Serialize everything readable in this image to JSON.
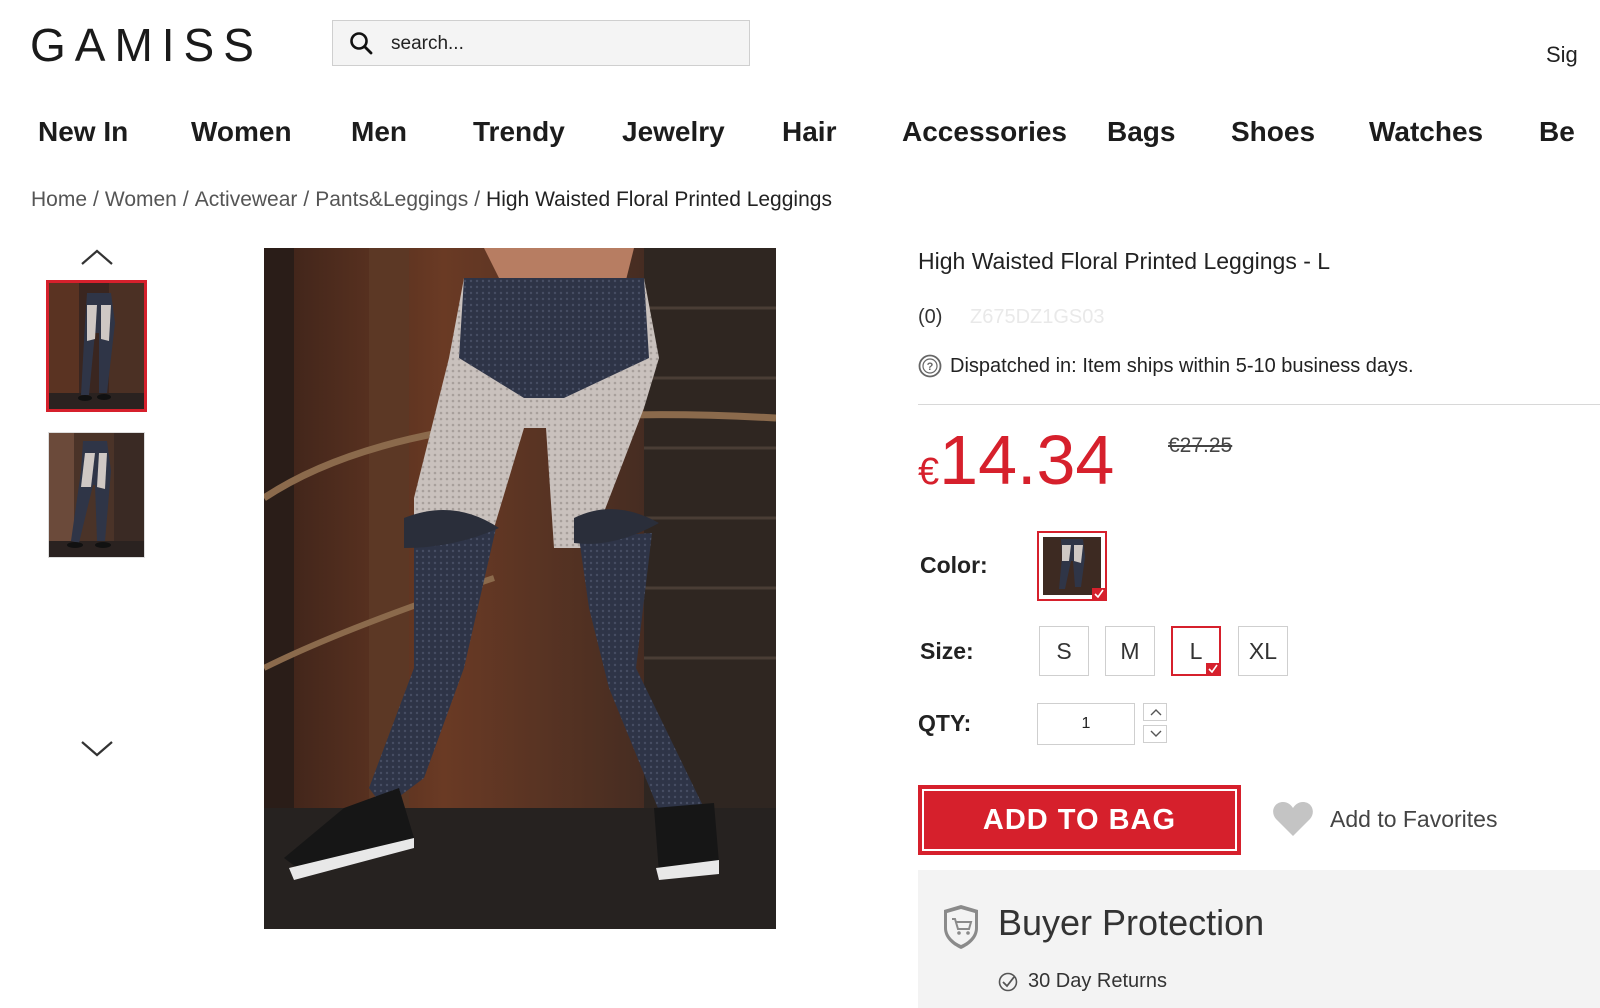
{
  "header": {
    "logo": "GAMISS",
    "search_placeholder": "search...",
    "signin_label": "Sig"
  },
  "nav": {
    "items": [
      "New In",
      "Women",
      "Men",
      "Trendy",
      "Jewelry",
      "Hair",
      "Accessories",
      "Bags",
      "Shoes",
      "Watches",
      "Be"
    ]
  },
  "breadcrumb": {
    "items": [
      "Home",
      "Women",
      "Activewear",
      "Pants&Leggings"
    ],
    "current": "High Waisted Floral Printed Leggings",
    "separator": "/"
  },
  "product": {
    "title": "High Waisted Floral Printed Leggings - L",
    "reviews": "(0)",
    "sku": "Z675DZ1GS03",
    "dispatch_label": "Dispatched in:",
    "dispatch_value": "Item ships within 5-10 business days.",
    "currency": "€",
    "price": "14.34",
    "old_price": "€27.25",
    "color_label": "Color:",
    "size_label": "Size:",
    "sizes": [
      "S",
      "M",
      "L",
      "XL"
    ],
    "selected_size": "L",
    "qty_label": "QTY:",
    "qty_value": "1",
    "add_to_bag": "ADD TO BAG",
    "add_to_favorites": "Add to Favorites"
  },
  "protection": {
    "title": "Buyer Protection",
    "item1": "30 Day Returns"
  },
  "colors": {
    "accent": "#d6202c",
    "text": "#222222",
    "panel": "#f3f3f3"
  },
  "icons": [
    "search-icon",
    "chevron-up-icon",
    "chevron-down-icon",
    "question-icon",
    "check-icon",
    "heart-icon",
    "shield-cart-icon",
    "check-circle-icon"
  ]
}
